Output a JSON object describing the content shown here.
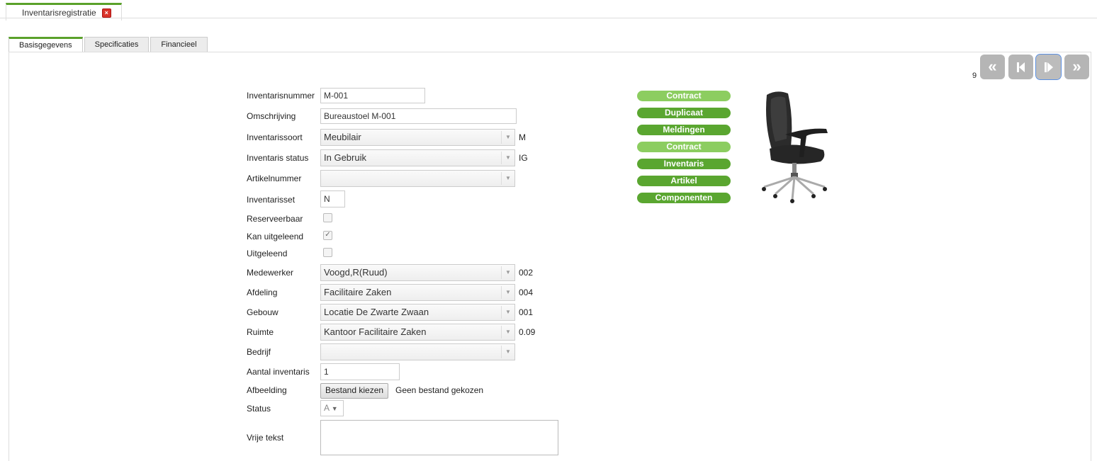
{
  "window": {
    "tab_title": "Inventarisregistratie"
  },
  "tabs": [
    {
      "label": "Basisgegevens"
    },
    {
      "label": "Specificaties"
    },
    {
      "label": "Financieel"
    }
  ],
  "navigation": {
    "record_number": "9"
  },
  "form": {
    "inventarisnummer": {
      "label": "Inventarisnummer",
      "value": "M-001"
    },
    "omschrijving": {
      "label": "Omschrijving",
      "value": "Bureaustoel M-001"
    },
    "inventarissoort": {
      "label": "Inventarissoort",
      "value": "Meubilair",
      "code": "M"
    },
    "inventaris_status": {
      "label": "Inventaris status",
      "value": "In Gebruik",
      "code": "IG"
    },
    "artikelnummer": {
      "label": "Artikelnummer",
      "value": ""
    },
    "inventarisset": {
      "label": "Inventarisset",
      "value": "N"
    },
    "reserveerbaar": {
      "label": "Reserveerbaar",
      "checked": false
    },
    "kan_uitgeleend": {
      "label": "Kan uitgeleend",
      "checked": true
    },
    "uitgeleend": {
      "label": "Uitgeleend",
      "checked": false
    },
    "medewerker": {
      "label": "Medewerker",
      "value": "Voogd,R(Ruud)",
      "code": "002"
    },
    "afdeling": {
      "label": "Afdeling",
      "value": "Facilitaire Zaken",
      "code": "004"
    },
    "gebouw": {
      "label": "Gebouw",
      "value": "Locatie De Zwarte Zwaan",
      "code": "001"
    },
    "ruimte": {
      "label": "Ruimte",
      "value": "Kantoor Facilitaire Zaken",
      "code": "0.09"
    },
    "bedrijf": {
      "label": "Bedrijf",
      "value": ""
    },
    "aantal_inventaris": {
      "label": "Aantal inventaris",
      "value": "1"
    },
    "afbeelding": {
      "label": "Afbeelding",
      "button": "Bestand kiezen",
      "status": "Geen bestand gekozen"
    },
    "status": {
      "label": "Status",
      "value": "A"
    },
    "vrije_tekst": {
      "label": "Vrije tekst",
      "value": ""
    }
  },
  "actions": [
    {
      "label": "Contract",
      "style": "light"
    },
    {
      "label": "Duplicaat",
      "style": "dark"
    },
    {
      "label": "Meldingen",
      "style": "dark"
    },
    {
      "label": "Contract",
      "style": "light"
    },
    {
      "label": "Inventaris",
      "style": "dark"
    },
    {
      "label": "Artikel",
      "style": "dark"
    },
    {
      "label": "Componenten",
      "style": "dark"
    }
  ],
  "colors": {
    "accent": "#5aa12a",
    "button_light": "#8ccd60",
    "button_dark": "#5aa630"
  }
}
